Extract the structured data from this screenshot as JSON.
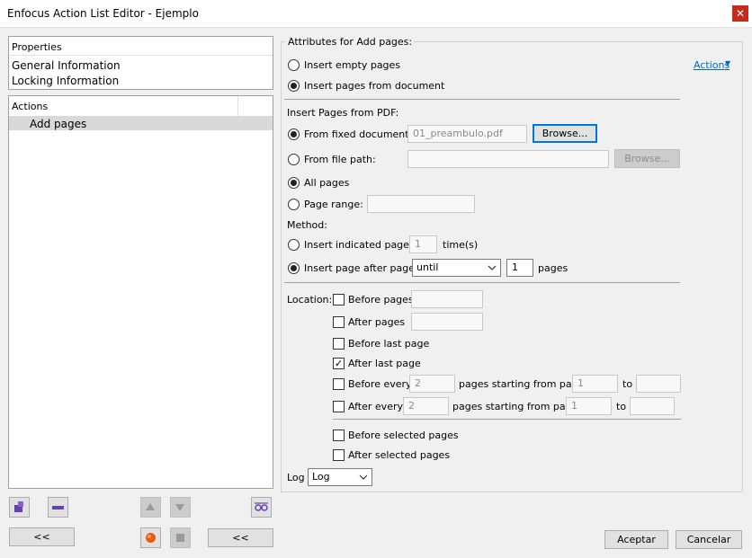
{
  "window": {
    "title": "Enfocus Action List Editor - Ejemplo",
    "close_glyph": "✕"
  },
  "left": {
    "properties_items": [
      "Properties",
      "General Information",
      "Locking Information"
    ],
    "actions_header": "Actions",
    "actions_items": [
      "Add pages"
    ],
    "collapse_label": "<<",
    "collapse_label2": "<<"
  },
  "right": {
    "group_title": "Attributes for Add pages:",
    "actions_link": "Actions",
    "actions_arrow": "▼",
    "insert_empty": "Insert empty pages",
    "insert_from_doc": "Insert pages from document",
    "insert_from_pdf": "Insert Pages from PDF:",
    "from_fixed": "From fixed document:",
    "fixed_value": "01_preambulo.pdf",
    "browse": "Browse...",
    "from_path": "From file path:",
    "path_value": "",
    "browse2": "Browse...",
    "all_pages": "All pages",
    "page_range": "Page range:",
    "range_value": "",
    "method": "Method:",
    "insert_indicated": "Insert indicated pages",
    "times_value": "1",
    "times_label": "time(s)",
    "insert_after": "Insert page after page",
    "until_value": "until",
    "until_count": "1",
    "pages_label": "pages",
    "location": "Location:",
    "before_pages": "Before pages",
    "before_pages_value": "",
    "after_pages": "After pages",
    "after_pages_value": "",
    "before_last": "Before last page",
    "after_last": "After last page",
    "before_every": "Before every",
    "before_every_n": "2",
    "before_every_mid": "pages starting from page",
    "before_every_start": "1",
    "before_every_to": "to",
    "before_every_end": "",
    "after_every": "After every",
    "after_every_n": "2",
    "after_every_mid": "pages starting from page",
    "after_every_start": "1",
    "after_every_to": "to",
    "after_every_end": "",
    "before_selected": "Before selected pages",
    "after_selected": "After selected pages",
    "log_label": "Log",
    "log_value": "Log",
    "check_glyph": "✓"
  },
  "footer": {
    "accept": "Aceptar",
    "cancel": "Cancelar"
  },
  "icons": [
    "add-action-icon",
    "remove-action-icon",
    "move-up-icon",
    "move-down-icon",
    "preview-glasses-icon",
    "run-icon",
    "stop-icon"
  ],
  "colors": {
    "accent": "#0078d7",
    "close": "#c42b1c",
    "link": "#0066cc"
  }
}
